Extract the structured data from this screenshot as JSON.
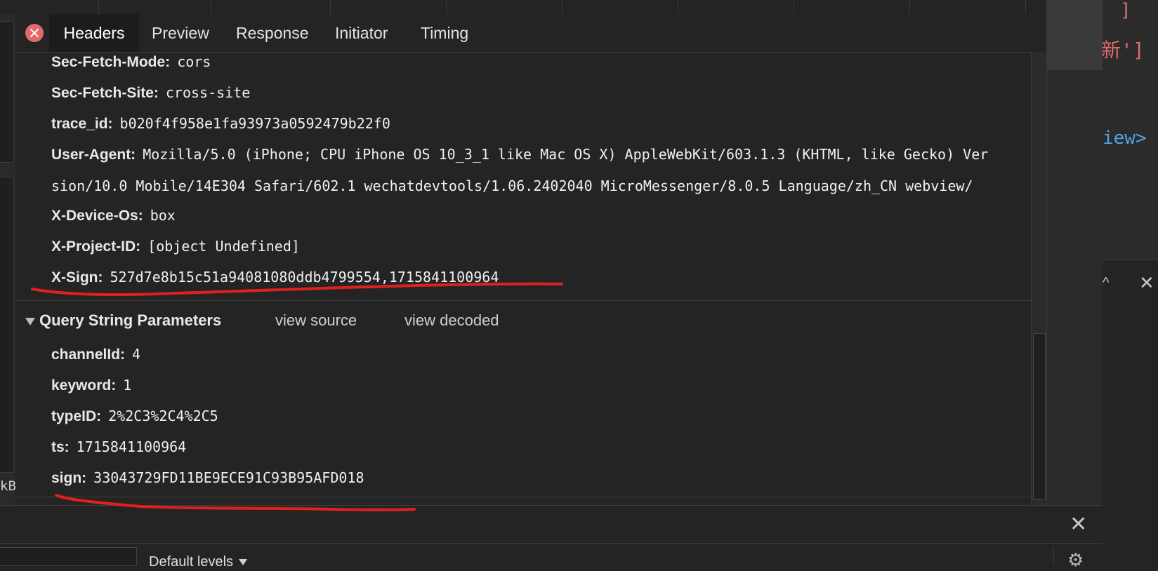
{
  "tabs": {
    "headers": "Headers",
    "preview": "Preview",
    "response": "Response",
    "initiator": "Initiator",
    "timing": "Timing"
  },
  "headers": {
    "sec_fetch_mode": {
      "key": "Sec-Fetch-Mode:",
      "value": "cors"
    },
    "sec_fetch_site": {
      "key": "Sec-Fetch-Site:",
      "value": "cross-site"
    },
    "trace_id": {
      "key": "trace_id:",
      "value": "b020f4f958e1fa93973a0592479b22f0"
    },
    "user_agent": {
      "key": "User-Agent:",
      "value_line1": "Mozilla/5.0 (iPhone; CPU iPhone OS 10_3_1 like Mac OS X) AppleWebKit/603.1.3 (KHTML, like Gecko) Ver",
      "value_line2": "sion/10.0 Mobile/14E304 Safari/602.1 wechatdevtools/1.06.2402040 MicroMessenger/8.0.5 Language/zh_CN webview/"
    },
    "x_device_os": {
      "key": "X-Device-Os:",
      "value": "box"
    },
    "x_project_id": {
      "key": "X-Project-ID:",
      "value": "[object Undefined]"
    },
    "x_sign": {
      "key": "X-Sign:",
      "value": "527d7e8b15c51a94081080ddb4799554,1715841100964"
    }
  },
  "query_section": {
    "title": "Query String Parameters",
    "view_source": "view source",
    "view_decoded": "view decoded",
    "params": [
      {
        "key": "channelId:",
        "value": "4"
      },
      {
        "key": "keyword:",
        "value": "1"
      },
      {
        "key": "typeID:",
        "value": "2%2C3%2C4%2C5"
      },
      {
        "key": "ts:",
        "value": "1715841100964"
      },
      {
        "key": "sign:",
        "value": "33043729FD11BE9ECE91C93B95AFD018"
      }
    ]
  },
  "right_panel": {
    "bracket": "]",
    "code_line1": "新']",
    "code_line2": "iew>",
    "caret": "^",
    "close": "✕"
  },
  "left_clip": "kB",
  "console": {
    "close": "✕",
    "levels": "Default levels",
    "gear": "⚙"
  },
  "colors": {
    "accent_red": "#e02020",
    "panel_bg": "#242424",
    "close_circle": "#e26a6a"
  }
}
